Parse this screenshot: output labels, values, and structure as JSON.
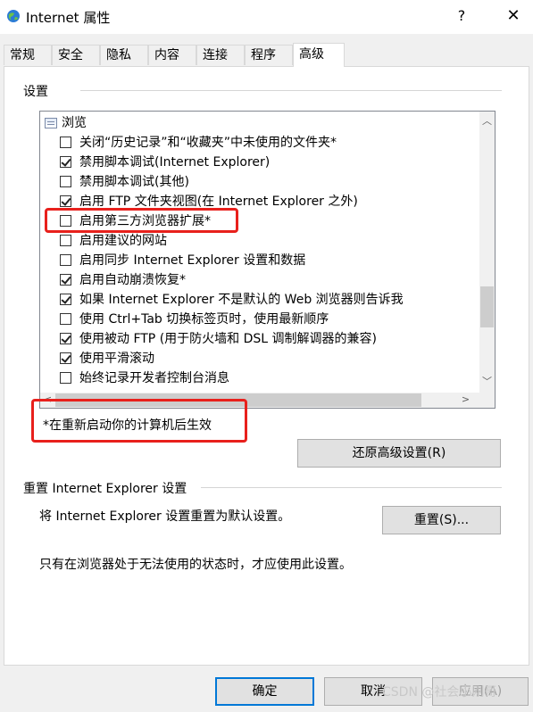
{
  "window": {
    "title": "Internet 属性",
    "help_label": "?",
    "close_label": "✕"
  },
  "tabs": [
    {
      "label": "常规"
    },
    {
      "label": "安全"
    },
    {
      "label": "隐私"
    },
    {
      "label": "内容"
    },
    {
      "label": "连接"
    },
    {
      "label": "程序"
    },
    {
      "label": "高级",
      "active": true
    }
  ],
  "settings_group": {
    "label": "设置",
    "category": "浏览",
    "items": [
      {
        "label": "关闭“历史记录”和“收藏夹”中未使用的文件夹*",
        "checked": false
      },
      {
        "label": "禁用脚本调试(Internet Explorer)",
        "checked": true
      },
      {
        "label": "禁用脚本调试(其他)",
        "checked": false
      },
      {
        "label": "启用 FTP 文件夹视图(在 Internet Explorer 之外)",
        "checked": true
      },
      {
        "label": "启用第三方浏览器扩展*",
        "checked": false
      },
      {
        "label": "启用建议的网站",
        "checked": false
      },
      {
        "label": "启用同步 Internet Explorer 设置和数据",
        "checked": false
      },
      {
        "label": "启用自动崩溃恢复*",
        "checked": true
      },
      {
        "label": "如果 Internet Explorer 不是默认的 Web 浏览器则告诉我",
        "checked": true
      },
      {
        "label": "使用 Ctrl+Tab 切换标签页时，使用最新顺序",
        "checked": false
      },
      {
        "label": "使用被动 FTP (用于防火墙和 DSL 调制解调器的兼容)",
        "checked": true
      },
      {
        "label": "使用平滑滚动",
        "checked": true
      },
      {
        "label": "始终记录开发者控制台消息",
        "checked": false
      }
    ],
    "note": "*在重新启动你的计算机后生效",
    "restore_button": "还原高级设置(R)"
  },
  "reset_group": {
    "label": "重置 Internet Explorer 设置",
    "description": "将 Internet Explorer 设置重置为默认设置。",
    "reset_button": "重置(S)...",
    "hint": "只有在浏览器处于无法使用的状态时，才应使用此设置。"
  },
  "footer": {
    "ok_button": "确定",
    "cancel_button": "取消",
    "apply_button": "应用(A)"
  },
  "watermark": "CSDN @社会小刚哥",
  "colors": {
    "highlight": "#e8201c",
    "focus": "#0078d7"
  }
}
